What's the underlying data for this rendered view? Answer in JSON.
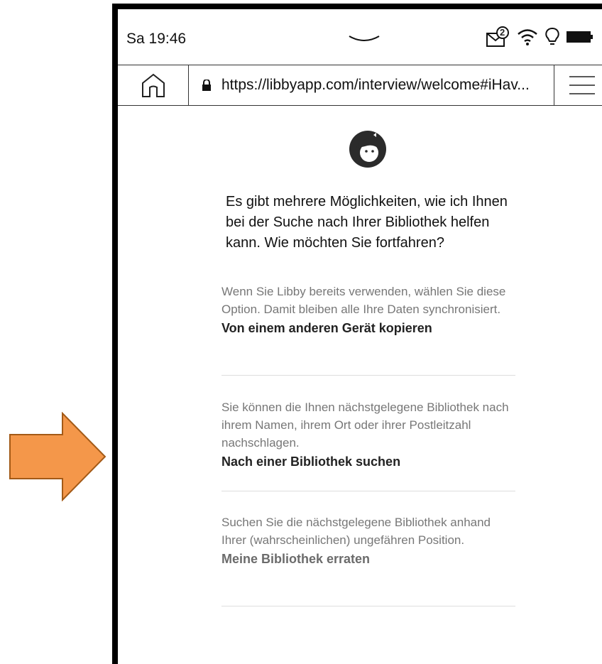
{
  "status": {
    "time": "Sa 19:46",
    "notification_count": "2"
  },
  "browser": {
    "url": "https://libbyapp.com/interview/welcome#iHav..."
  },
  "page": {
    "intro": "Es gibt mehrere Möglichkeiten, wie ich Ihnen bei der Suche nach Ihrer Bibliothek helfen kann. Wie möchten Sie fortfahren?",
    "options": [
      {
        "description": "Wenn Sie Libby bereits verwenden, wählen Sie diese Option. Damit bleiben alle Ihre Daten synchronisiert.",
        "action": "Von einem anderen Gerät kopieren"
      },
      {
        "description": "Sie können die Ihnen nächstgelegene Bibliothek nach ihrem Namen, ihrem Ort oder ihrer Postleitzahl nachschlagen.",
        "action": "Nach einer Bibliothek suchen"
      },
      {
        "description": "Suchen Sie die nächstgelegene Bibliothek anhand Ihrer (wahrscheinlichen) ungefähren Position.",
        "action": "Meine Bibliothek erraten"
      }
    ]
  },
  "colors": {
    "arrow": "#f4974a",
    "arrow_outline": "#a35a17"
  }
}
